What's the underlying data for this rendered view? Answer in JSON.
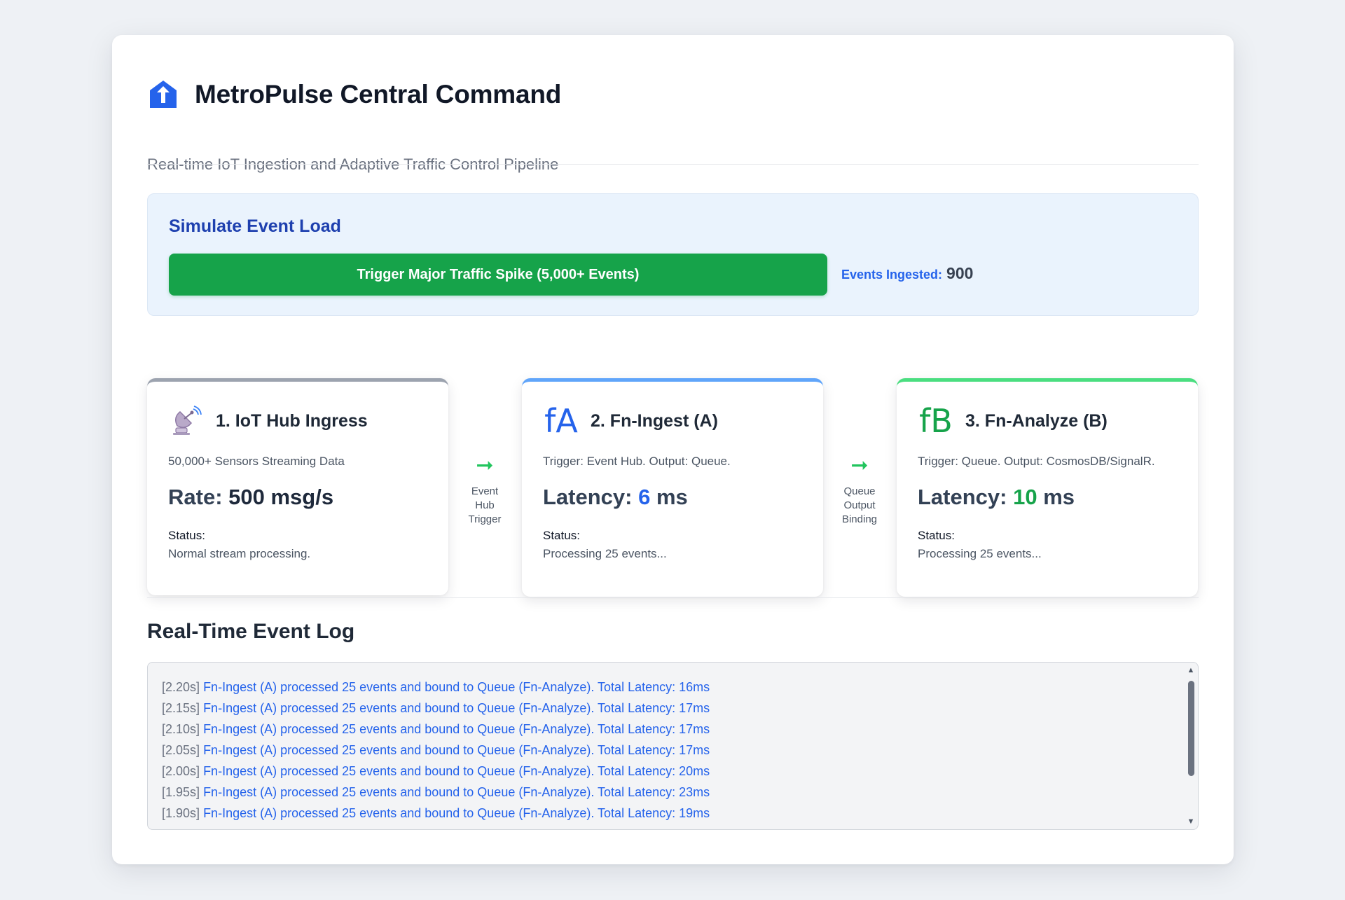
{
  "header": {
    "title": "MetroPulse Central Command",
    "subtitle": "Real-time IoT Ingestion and Adaptive Traffic Control Pipeline",
    "logo_icon": "home-arrow-icon"
  },
  "simulate": {
    "title": "Simulate Event Load",
    "button_label": "Trigger Major Traffic Spike (5,000+ Events)",
    "events_ingested_label": "Events Ingested:",
    "events_ingested_value": "900"
  },
  "stages": [
    {
      "icon": "satellite-dish-icon",
      "title": "1. IoT Hub Ingress",
      "description": "50,000+ Sensors Streaming Data",
      "metric_label": "Rate:",
      "metric_value": "500 msg/s",
      "metric_unit": "",
      "status_label": "Status:",
      "status_text": "Normal stream processing.",
      "accent": "#9ca3af"
    },
    {
      "icon": "fA",
      "title": "2. Fn-Ingest (A)",
      "description": "Trigger: Event Hub. Output: Queue.",
      "metric_label": "Latency:",
      "metric_value": "6",
      "metric_unit": "ms",
      "status_label": "Status:",
      "status_text": "Processing 25 events...",
      "accent": "#60a5fa"
    },
    {
      "icon": "fB",
      "title": "3. Fn-Analyze (B)",
      "description": "Trigger: Queue. Output: CosmosDB/SignalR.",
      "metric_label": "Latency:",
      "metric_value": "10",
      "metric_unit": "ms",
      "status_label": "Status:",
      "status_text": "Processing 25 events...",
      "accent": "#4ade80"
    }
  ],
  "connectors": [
    {
      "arrow": "➞",
      "label": "Event Hub Trigger"
    },
    {
      "arrow": "➞",
      "label": "Queue Output Binding"
    }
  ],
  "log": {
    "title": "Real-Time Event Log",
    "entries": [
      {
        "time": "[2.20s]",
        "message": "Fn-Ingest (A) processed 25 events and bound to Queue (Fn-Analyze). Total Latency: 16ms"
      },
      {
        "time": "[2.15s]",
        "message": "Fn-Ingest (A) processed 25 events and bound to Queue (Fn-Analyze). Total Latency: 17ms"
      },
      {
        "time": "[2.10s]",
        "message": "Fn-Ingest (A) processed 25 events and bound to Queue (Fn-Analyze). Total Latency: 17ms"
      },
      {
        "time": "[2.05s]",
        "message": "Fn-Ingest (A) processed 25 events and bound to Queue (Fn-Analyze). Total Latency: 17ms"
      },
      {
        "time": "[2.00s]",
        "message": "Fn-Ingest (A) processed 25 events and bound to Queue (Fn-Analyze). Total Latency: 20ms"
      },
      {
        "time": "[1.95s]",
        "message": "Fn-Ingest (A) processed 25 events and bound to Queue (Fn-Analyze). Total Latency: 23ms"
      },
      {
        "time": "[1.90s]",
        "message": "Fn-Ingest (A) processed 25 events and bound to Queue (Fn-Analyze). Total Latency: 19ms"
      }
    ]
  },
  "colors": {
    "accent_blue": "#2563eb",
    "accent_green": "#16a34a",
    "panel_bg": "#eaf3fd",
    "title_blue": "#1e40af"
  }
}
